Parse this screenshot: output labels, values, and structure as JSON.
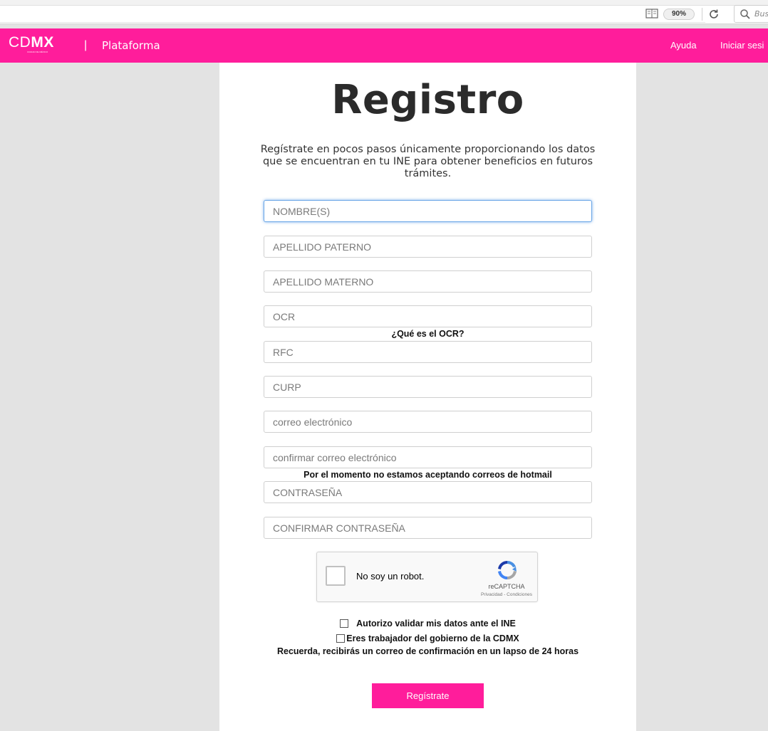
{
  "browser": {
    "zoom": "90%",
    "search_placeholder": "Bus"
  },
  "header": {
    "logo_light": "CD",
    "logo_bold": "MX",
    "logo_tagline": "CIUDAD DE MÉXICO",
    "separator": "|",
    "platform": "Plataforma",
    "help": "Ayuda",
    "login": "Iniciar sesi"
  },
  "form": {
    "title": "Registro",
    "intro": "Regístrate en pocos pasos únicamente proporcionando los datos que se encuentran en tu INE para obtener beneficios en futuros trámites.",
    "fields": {
      "nombre": "NOMBRE(S)",
      "apellido_paterno": "APELLIDO PATERNO",
      "apellido_materno": "APELLIDO MATERNO",
      "ocr": "OCR",
      "rfc": "RFC",
      "curp": "CURP",
      "correo": "correo electrónico",
      "confirmar_correo": "confirmar correo electrónico",
      "contrasena": "CONTRASEÑA",
      "confirmar_contrasena": "CONFIRMAR CONTRASEÑA"
    },
    "ocr_help": "¿Qué es el OCR?",
    "hotmail_notice": "Por el momento no estamos aceptando correos de hotmail",
    "captcha": {
      "label": "No soy un robot.",
      "brand": "reCAPTCHA",
      "links": "Privacidad - Condiciones"
    },
    "authorize": "Autorizo validar mis datos ante el INE",
    "gov_worker": "Eres trabajador del gobierno de la CDMX",
    "reminder": "Recuerda, recibirás un correo de confirmación en un lapso de 24 horas",
    "submit": "Regístrate"
  },
  "colors": {
    "brand": "#ff1d9b",
    "background": "#e3e3e3",
    "panel": "#ffffff"
  }
}
